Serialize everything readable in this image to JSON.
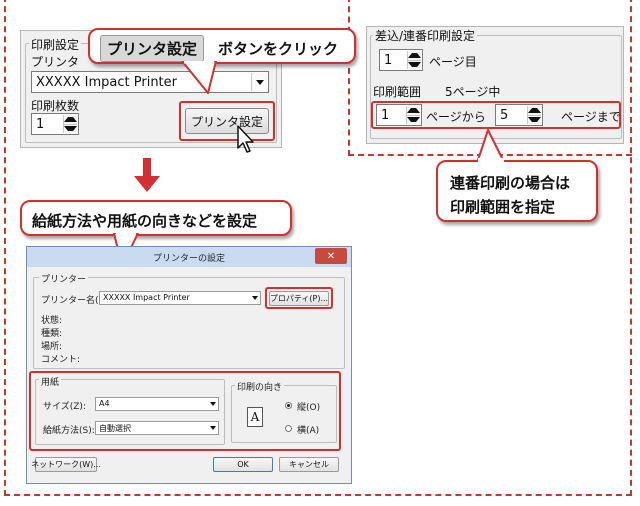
{
  "print_panel": {
    "group_label": "印刷設定",
    "printer_label": "プリンタ",
    "printer_value": "XXXXX Impact Printer",
    "copies_label": "印刷枚数",
    "copies_value": "1",
    "printer_settings_button": "プリンタ設定"
  },
  "callout_top": {
    "highlight": "プリンタ設定",
    "text": "ボタンをクリック"
  },
  "callout_middle": {
    "text": "給紙方法や用紙の向きなどを設定"
  },
  "callout_right": {
    "line1": "連番印刷の場合は",
    "line2": "印刷範囲を指定"
  },
  "serial_panel": {
    "group_label": "差込/連番印刷設定",
    "page_value": "1",
    "page_suffix": "ページ目",
    "range_label": "印刷範囲",
    "range_total": "5ページ中",
    "range_from_value": "1",
    "range_from_suffix": "ページから",
    "range_to_value": "5",
    "range_to_suffix": "ページまで"
  },
  "dialog": {
    "title": "プリンターの設定",
    "close": "✕",
    "printer_group": "プリンター",
    "printer_name_label": "プリンター名(N):",
    "printer_name_value": "XXXXX Impact Printer",
    "properties_button": "プロパティ(P)...",
    "status_label": "状態:",
    "type_label": "種類:",
    "location_label": "場所:",
    "comment_label": "コメント:",
    "paper_group": "用紙",
    "size_label": "サイズ(Z):",
    "size_value": "A4",
    "source_label": "給紙方法(S):",
    "source_value": "自動選択",
    "orientation_group": "印刷の向き",
    "orientation_glyph": "A",
    "portrait_label": "縦(O)",
    "landscape_label": "横(A)",
    "network_button": "ネットワーク(W)...",
    "ok_button": "OK",
    "cancel_button": "キャンセル"
  },
  "colors": {
    "accent_red": "#d32f2f",
    "dialog_titlebar": "#c9dbf0",
    "panel_bg": "#f0f0f0"
  }
}
